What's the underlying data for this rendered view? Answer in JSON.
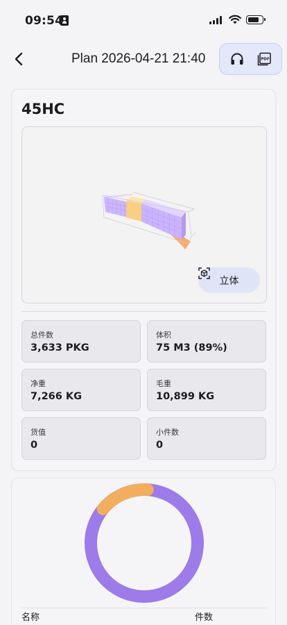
{
  "status_bar": {
    "time": "09:54"
  },
  "nav": {
    "title": "Plan 2026-04-21 21:40"
  },
  "actions": {
    "pdf_label": "PDF"
  },
  "container": {
    "type": "45HC",
    "view_3d_label": "立体",
    "stats": [
      {
        "label": "总件数",
        "value": "3,633 PKG"
      },
      {
        "label": "体积",
        "value": "75 M3 (89%)"
      },
      {
        "label": "净重",
        "value": "7,266 KG"
      },
      {
        "label": "毛重",
        "value": "10,899 KG"
      },
      {
        "label": "货值",
        "value": "0"
      },
      {
        "label": "小件数",
        "value": "0"
      }
    ]
  },
  "chart_data": {
    "type": "pie",
    "segments": [
      {
        "value": 85,
        "color": "#9d7be8"
      },
      {
        "value": 15,
        "color": "#f2ad5e"
      }
    ]
  },
  "table": {
    "headers": [
      "名称",
      "件数"
    ]
  },
  "colors": {
    "accent": "#e4e8fb",
    "purple": "#9d7be8",
    "orange": "#f2ad5e"
  }
}
